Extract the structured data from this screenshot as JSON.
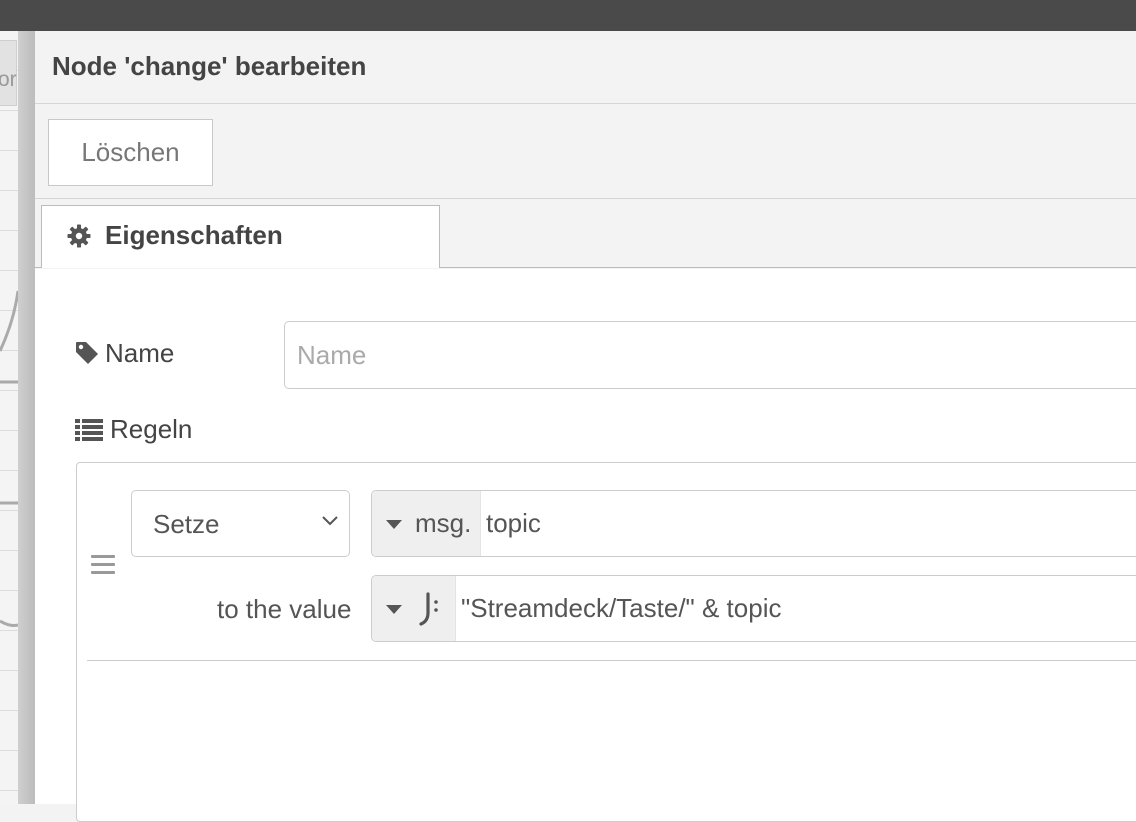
{
  "workspace": {
    "tab_fragment": "or"
  },
  "tray": {
    "title": "Node 'change' bearbeiten",
    "delete_button": "Löschen",
    "tabs": [
      {
        "label": "Eigenschaften",
        "icon": "gear-icon"
      }
    ]
  },
  "properties": {
    "name_label": "Name",
    "name_icon": "tag-icon",
    "name_placeholder": "Name",
    "name_value": "",
    "rules_label": "Regeln",
    "rules_icon": "list-icon"
  },
  "rules": [
    {
      "action": "Setze",
      "property_type": "msg.",
      "property_value": "topic",
      "to_label": "to the value",
      "value_type_icon": "jsonata-icon",
      "value": "\"Streamdeck/Taste/\" & topic"
    }
  ],
  "colors": {
    "topbar": "#4a4a4a",
    "tray_bg": "#f3f3f3",
    "content_bg": "#ffffff",
    "border": "#cccccc"
  }
}
